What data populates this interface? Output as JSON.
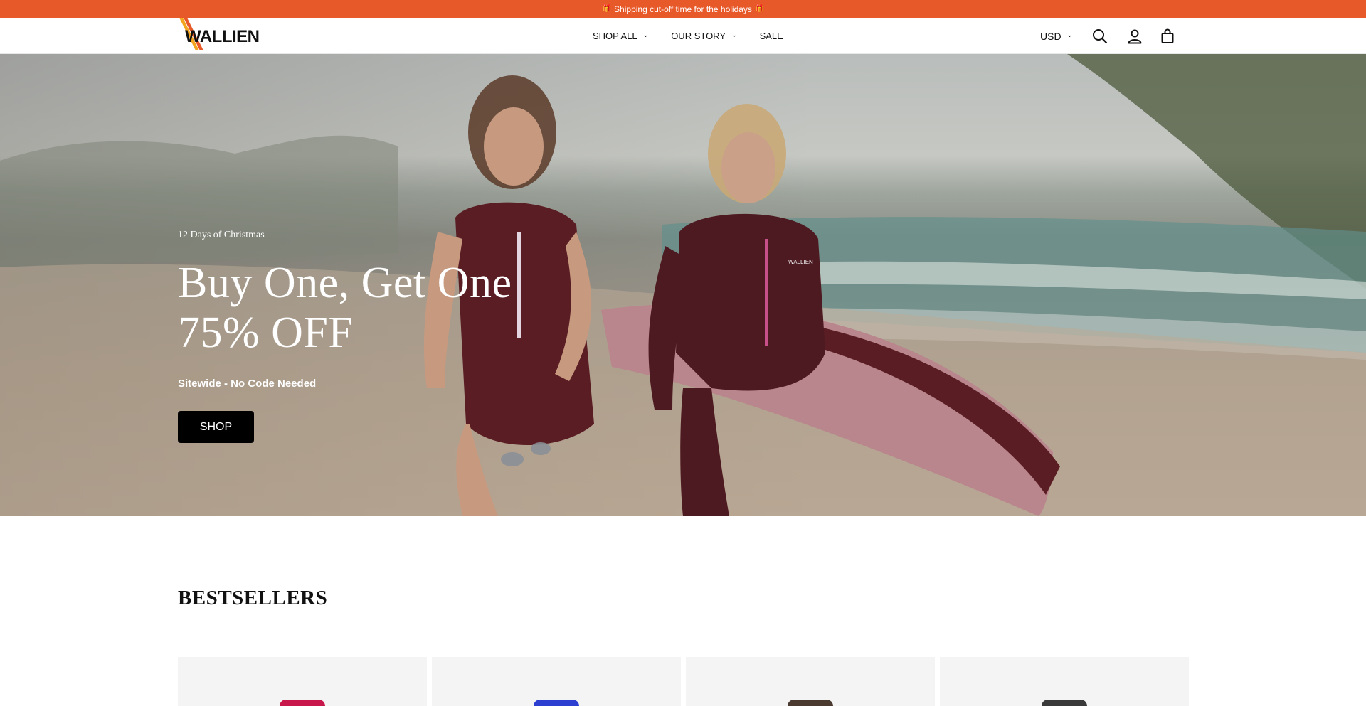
{
  "announcement": {
    "emoji_left": "🎁",
    "text": "Shipping cut-off time for the holidays",
    "emoji_right": "🎁"
  },
  "header": {
    "logo_text": "WALLIEN",
    "nav": [
      {
        "label": "SHOP ALL",
        "has_dropdown": true
      },
      {
        "label": "OUR STORY",
        "has_dropdown": true
      },
      {
        "label": "SALE",
        "has_dropdown": false
      }
    ],
    "currency": "USD",
    "icons": [
      "search-icon",
      "account-icon",
      "cart-icon"
    ]
  },
  "hero": {
    "eyebrow": "12 Days of Christmas",
    "headline_line1": "Buy One, Get One",
    "headline_line2": "75% OFF",
    "subhead": "Sitewide - No Code Needed",
    "cta": "SHOP",
    "suit_brand": "WALLIEN"
  },
  "bestsellers": {
    "title": "BESTSELLERS",
    "cards": [
      {
        "accent": "#c8174a"
      },
      {
        "accent": "#2d3fd1"
      },
      {
        "accent": "#4a3a30"
      },
      {
        "accent": "#3a3a3a"
      }
    ]
  },
  "colors": {
    "announcement_bg": "#e8592a",
    "cta_bg": "#000000",
    "card_bg": "#f4f4f4"
  }
}
